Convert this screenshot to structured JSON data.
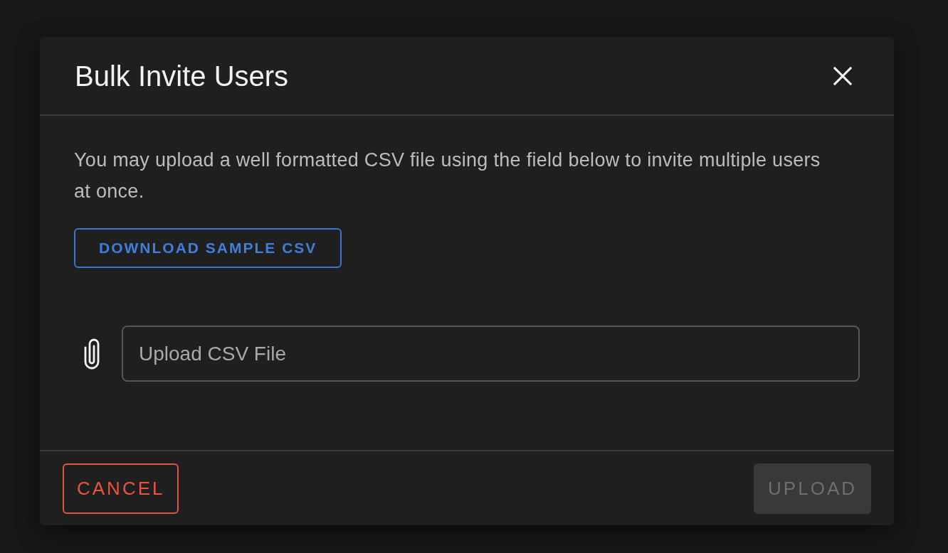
{
  "dialog": {
    "title": "Bulk Invite Users",
    "description": "You may upload a well formatted CSV file using the field below to invite multiple users at once.",
    "download_button": "DOWNLOAD SAMPLE CSV",
    "file_field": {
      "placeholder": "Upload CSV File"
    },
    "buttons": [
      {
        "label": "CANCEL",
        "kind": "cancel",
        "disabled": false
      },
      {
        "label": "UPLOAD",
        "kind": "submit",
        "disabled": true
      }
    ]
  }
}
